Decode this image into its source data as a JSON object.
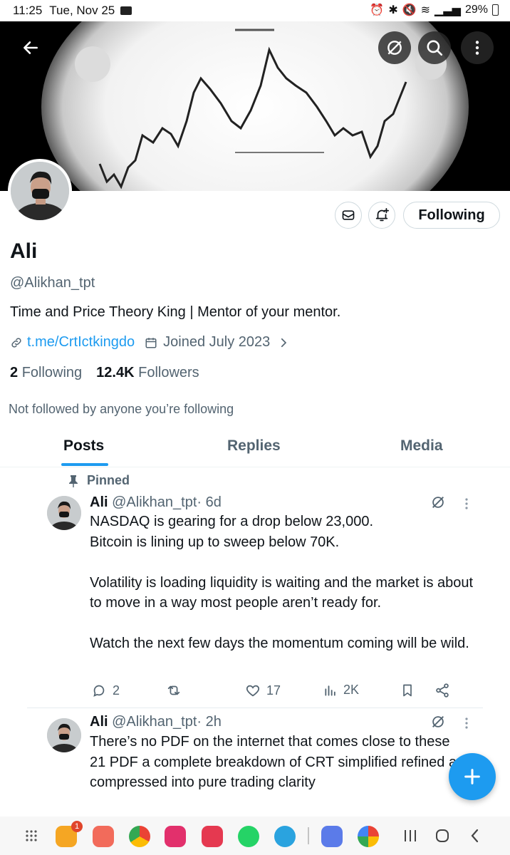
{
  "status_bar": {
    "time": "11:25",
    "date": "Tue, Nov 25",
    "battery": "29%"
  },
  "profile": {
    "name": "Ali",
    "handle": "@Alikhan_tpt",
    "bio": "Time and Price Theory King | Mentor of your mentor.",
    "link": "t.me/CrtIctkingdo",
    "joined": "Joined July 2023",
    "following_count": "2",
    "following_label": "Following",
    "followers_count": "12.4K",
    "followers_label": "Followers",
    "not_followed": "Not followed by anyone you’re following",
    "follow_button": "Following"
  },
  "tabs": [
    {
      "label": "Posts"
    },
    {
      "label": "Replies"
    },
    {
      "label": "Media"
    }
  ],
  "posts": [
    {
      "pinned_label": "Pinned",
      "name": "Ali",
      "handle": "@Alikhan_tpt",
      "time": "· 6d",
      "text": "NASDAQ is gearing for a drop below 23,000.\nBitcoin is lining up to sweep below 70K.\n\nVolatility is loading liquidity is waiting and the market is about to move in a way most people aren’t ready for.\n\nWatch the next few days  the momentum coming will be wild.",
      "replies": "2",
      "likes": "17",
      "views": "2K"
    },
    {
      "name": "Ali",
      "handle": "@Alikhan_tpt",
      "time": "· 2h",
      "text": "There’s no PDF on the internet that comes close to these\n21 PDF  a complete breakdown of CRT simplified refined and compressed into pure trading clarity"
    }
  ],
  "nav": {
    "notification_badge": "1"
  },
  "colors": {
    "accent": "#1d9bf0",
    "text": "#0f1419",
    "muted": "#536471"
  }
}
